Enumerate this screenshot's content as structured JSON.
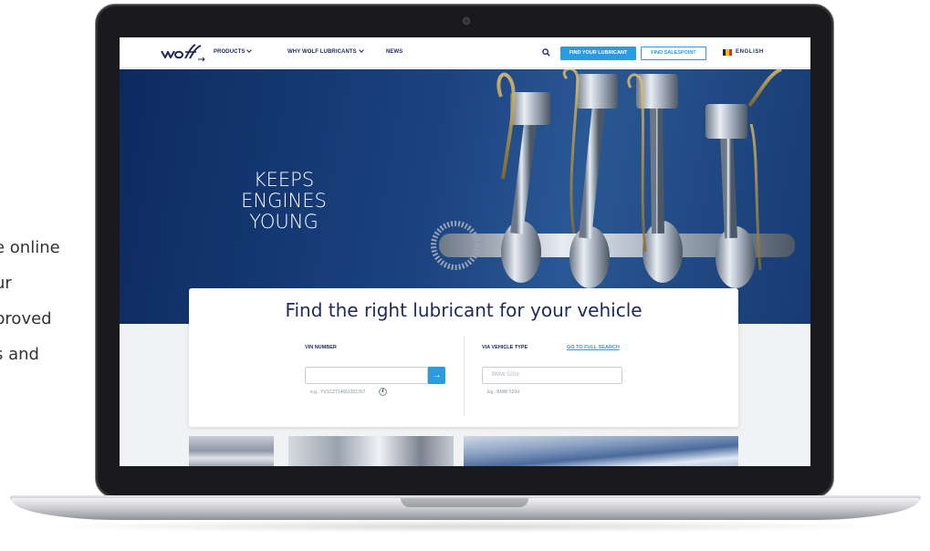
{
  "side_text": [
    "e online",
    "ur",
    "proved",
    "s and"
  ],
  "nav": {
    "menu": [
      "PRODUCTS",
      "WHY WOLF LUBRICANTS",
      "NEWS"
    ],
    "find_lubricant": "FIND YOUR LUBRICANT",
    "find_salespoint": "FIND SALESPOINT",
    "language": "ENGLISH"
  },
  "hero": {
    "title_line1": "KEEPS ENGINES",
    "title_line2": "YOUNG"
  },
  "search": {
    "title": "Find the right lubricant for your vehicle",
    "vin_label": "VIN NUMBER",
    "vin_hint": "e.g.: YV1CZ714661301357",
    "vehicle_label": "VIA VEHICLE TYPE",
    "full_search_link": "GO TO FULL SEARCH",
    "vehicle_placeholder": "BMW 520d",
    "vehicle_hint": "Eg.: BMW 520d"
  },
  "colors": {
    "brand_navy": "#1e2a55",
    "accent_blue": "#2a9be0"
  },
  "icons": {
    "search": "search-icon",
    "submit": "arrow-right-icon",
    "info": "info-icon",
    "flag": "belgium-flag-icon"
  }
}
